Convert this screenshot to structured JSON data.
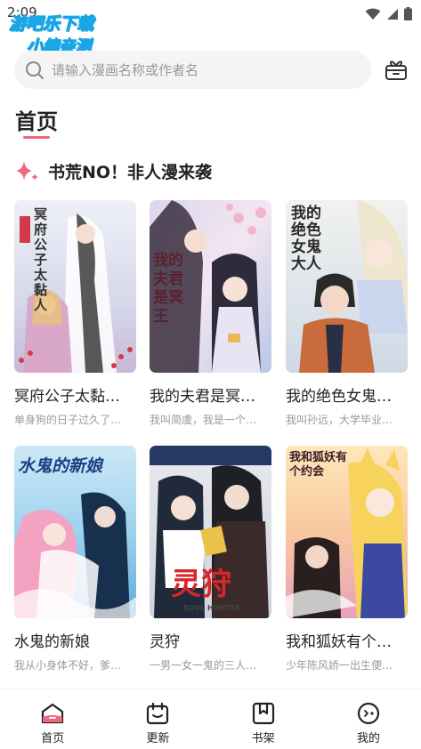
{
  "status_bar": {
    "time": "2:09"
  },
  "watermark": {
    "line1": "游吧乐下载",
    "line2": "小编亲测"
  },
  "search": {
    "placeholder": "请输入漫画名称或作者名"
  },
  "page_title": "首页",
  "section": {
    "title": "书荒NO！非人漫来袭"
  },
  "comics": [
    {
      "title": "冥府公子太黏…",
      "desc": "单身狗的日子过久了…",
      "cover_text": "冥府公子太黏人"
    },
    {
      "title": "我的夫君是冥…",
      "desc": "我叫简虞，我是一个…",
      "cover_text": "我的夫君是冥王"
    },
    {
      "title": "我的绝色女鬼…",
      "desc": "我叫孙远，大学毕业…",
      "cover_text": "我的绝色女鬼大人"
    },
    {
      "title": "水鬼的新娘",
      "desc": "我从小身体不好，爹…",
      "cover_text": "水鬼的新娘"
    },
    {
      "title": "灵狩",
      "desc": "一男一女一鬼的三人…",
      "cover_text": "灵狩",
      "cover_sub": "SOUL HUNTER"
    },
    {
      "title": "我和狐妖有个…",
      "desc": "少年陈风娇一出生便…",
      "cover_text": "我和狐妖有个约会"
    }
  ],
  "nav": [
    {
      "label": "首页",
      "icon": "home-icon"
    },
    {
      "label": "更新",
      "icon": "calendar-icon"
    },
    {
      "label": "书架",
      "icon": "bookmark-icon"
    },
    {
      "label": "我的",
      "icon": "profile-icon"
    }
  ],
  "colors": {
    "accent": "#f2667e",
    "search_bg": "#f4f4f4",
    "muted_text": "#999999"
  }
}
